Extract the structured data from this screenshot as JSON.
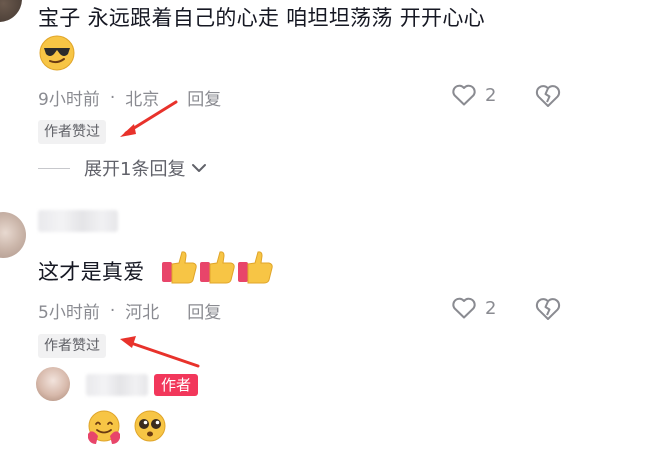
{
  "comments": [
    {
      "text": "宝子 永远跟着自己的心走 咱坦坦荡荡 开开心心",
      "emoji_icon": "sunglasses-face-emoji",
      "time": "9小时前",
      "separator": "·",
      "location": "北京",
      "reply_label": "回复",
      "like_count": "2",
      "liked_tag": "作者赞过",
      "expand_label": "展开1条回复",
      "heart_icon": "heart-outline-icon",
      "dislike_icon": "broken-heart-icon"
    },
    {
      "text": "这才是真爱",
      "emoji_icons": [
        "thumbs-up-emoji",
        "thumbs-up-emoji",
        "thumbs-up-emoji"
      ],
      "time": "5小时前",
      "separator": "·",
      "location": "河北",
      "reply_label": "回复",
      "like_count": "2",
      "liked_tag": "作者赞过",
      "heart_icon": "heart-outline-icon",
      "dislike_icon": "broken-heart-icon"
    }
  ],
  "reply": {
    "badge": "作者",
    "emoji_icons": [
      "hugging-face-emoji",
      "pleading-face-emoji"
    ]
  },
  "colors": {
    "meta_gray": "#8a8b91",
    "badge_bg": "#f2375b",
    "arrow_red": "#e8322b",
    "tag_bg": "#f1f1f2"
  }
}
